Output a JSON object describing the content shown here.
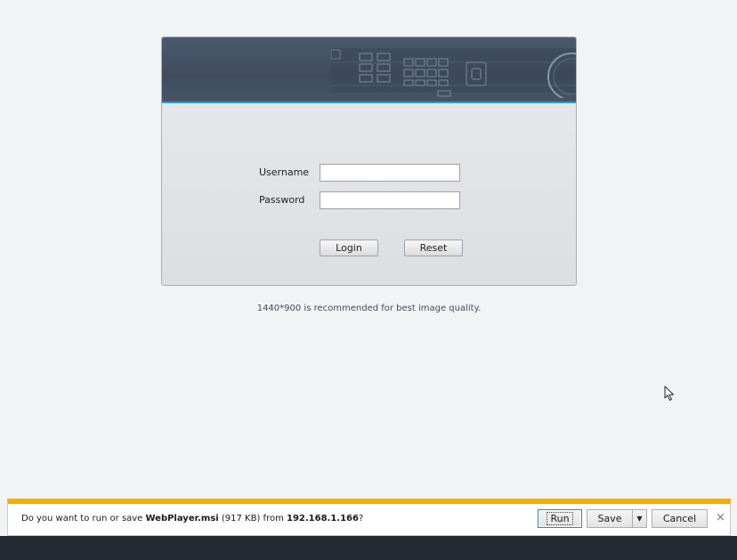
{
  "login": {
    "username_label": "Username",
    "username_value": "",
    "password_label": "Password",
    "password_value": "",
    "login_button": "Login",
    "reset_button": "Reset"
  },
  "hint": "1440*900 is recommended for best image quality.",
  "download_bar": {
    "prefix": "Do you want to run or save ",
    "filename": "WebPlayer.msi",
    "size": " (917 KB) from ",
    "host": "192.168.1.166",
    "suffix": "?",
    "run_button": "Run",
    "save_button": "Save",
    "save_dropdown_icon": "▼",
    "cancel_button": "Cancel",
    "close_icon": "×"
  },
  "colors": {
    "background": "#f2f3f5",
    "banner": "#445366",
    "banner_accent": "#2d9bd0",
    "notification_accent": "#f4ae00",
    "taskbar": "#232a34"
  }
}
